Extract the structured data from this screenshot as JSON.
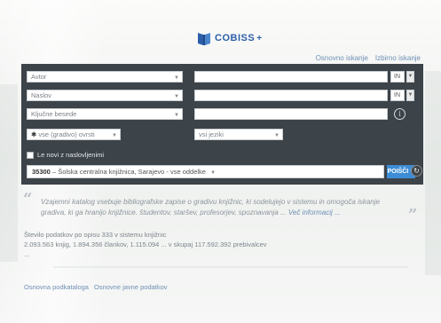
{
  "logo": {
    "text": "COBISS",
    "plus": "+"
  },
  "top_links": [
    "Osnovno iskanje",
    "Izbirno iskanje"
  ],
  "search_rows": [
    {
      "field": "Avtor",
      "operator": "IN"
    },
    {
      "field": "Naslov",
      "operator": "IN"
    },
    {
      "field": "Ključne besede"
    }
  ],
  "filters": {
    "type": "vse (gradivo) ovrsti",
    "language": "vsi jeziki"
  },
  "checkbox_label": "Le novi z naslovljenimi",
  "library": {
    "code": "35300",
    "name": "Šolska centralna knjižnica, Sarajevo - vse oddelke"
  },
  "search_button": "POIŠČI",
  "info_icon": "i",
  "quote": {
    "text": "Vzajemni katalog vsebuje bibliografske zapise o gradivu knjižnic, ki sodelujejo v sistemu in omogoča iskanje gradiva, ki ga hranijo knjižnice.",
    "text2": "študentov, staršev, profesorjev, spoznavanja ...",
    "more": "Več informacij ..."
  },
  "stats": {
    "line1": "Število podatkov po opisu 333 v sistemu knjižnic",
    "line2": "2.093.563 knjig, 1.894.356 člankov, 1.115.094 ... v skupaj 117.592.392 prebivalcev ..."
  },
  "bottom_links": [
    "Osnovna podkataloga",
    "Osnovne javne podatkov"
  ]
}
